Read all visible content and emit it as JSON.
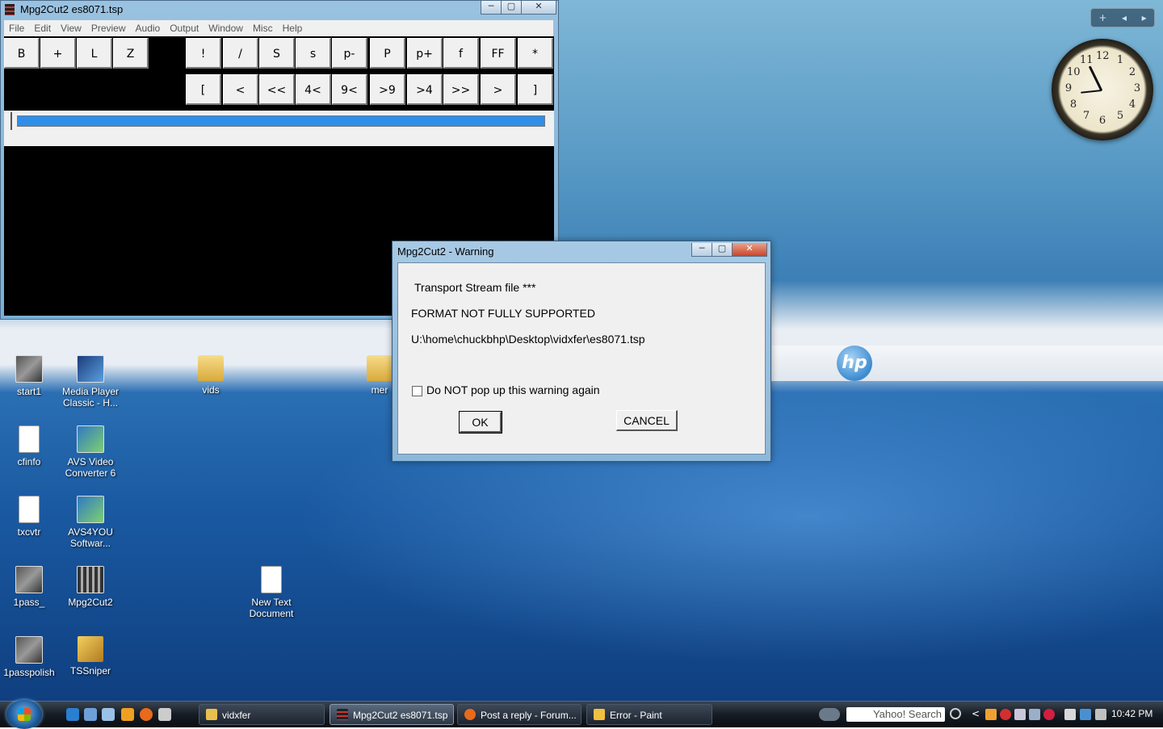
{
  "main_window": {
    "title": "Mpg2Cut2 es8071.tsp",
    "caption_minimize": "─",
    "caption_maximize": "▢",
    "caption_close": "✕",
    "menu": [
      "File",
      "Edit",
      "View",
      "Preview",
      "Audio",
      "Output",
      "Window",
      "Misc",
      "Help"
    ],
    "toolbar_row1_left": [
      "B",
      "+",
      "L",
      "Z"
    ],
    "toolbar_row1_right": [
      "!",
      "/",
      "S",
      "s",
      "p-",
      "P",
      "p+",
      "f",
      "FF",
      "*"
    ],
    "toolbar_row2": [
      "[",
      "<",
      "<<",
      "4<",
      "9<",
      ">9",
      ">4",
      ">>",
      ">",
      "]"
    ]
  },
  "dialog": {
    "title": "Mpg2Cut2 - Warning",
    "line1": "Transport Stream file ***",
    "line2": "FORMAT NOT FULLY SUPPORTED",
    "line3": "U:\\home\\chuckbhp\\Desktop\\vidxfer\\es8071.tsp",
    "checkbox_label": "Do NOT pop up this warning again",
    "checkbox_checked": false,
    "ok_label": "OK",
    "cancel_label": "CANCEL",
    "caption_minimize": "─",
    "caption_maximize": "▢",
    "caption_close": "✕"
  },
  "desktop_icons": [
    {
      "label": "start1",
      "icon": "video-thumbnail-icon"
    },
    {
      "label": "Media Player Classic - H...",
      "icon": "media-player-icon"
    },
    {
      "label": "vids",
      "icon": "folder-icon"
    },
    {
      "label": "mer",
      "icon": "folder-icon"
    },
    {
      "label": "cfinfo",
      "icon": "text-file-icon"
    },
    {
      "label": "AVS Video Converter 6",
      "icon": "avs-converter-icon"
    },
    {
      "label": "txcvtr",
      "icon": "program-icon"
    },
    {
      "label": "AVS4YOU Softwar...",
      "icon": "avs4you-icon"
    },
    {
      "label": "1pass_",
      "icon": "video-thumbnail-icon"
    },
    {
      "label": "Mpg2Cut2",
      "icon": "mpg2cut2-icon"
    },
    {
      "label": "New Text Document",
      "icon": "text-file-icon"
    },
    {
      "label": "1passpolish",
      "icon": "video-thumbnail-icon"
    },
    {
      "label": "TSSniper",
      "icon": "tssniper-icon"
    }
  ],
  "desktop_logo": "hp",
  "sidebar": {
    "add": "+",
    "prev": "◂",
    "next": "▸",
    "clock_numbers": [
      "12",
      "1",
      "2",
      "3",
      "4",
      "5",
      "6",
      "7",
      "8",
      "9",
      "10",
      "11"
    ]
  },
  "taskbar": {
    "tasks": [
      {
        "label": "vidxfer",
        "active": false
      },
      {
        "label": "Mpg2Cut2 es8071.tsp",
        "active": true
      },
      {
        "label": "Post a reply - Forum...",
        "active": false
      },
      {
        "label": "Error - Paint",
        "active": false
      }
    ],
    "search_placeholder": "Yahoo! Search",
    "tray_arrow": "<",
    "time": "10:42 PM"
  }
}
